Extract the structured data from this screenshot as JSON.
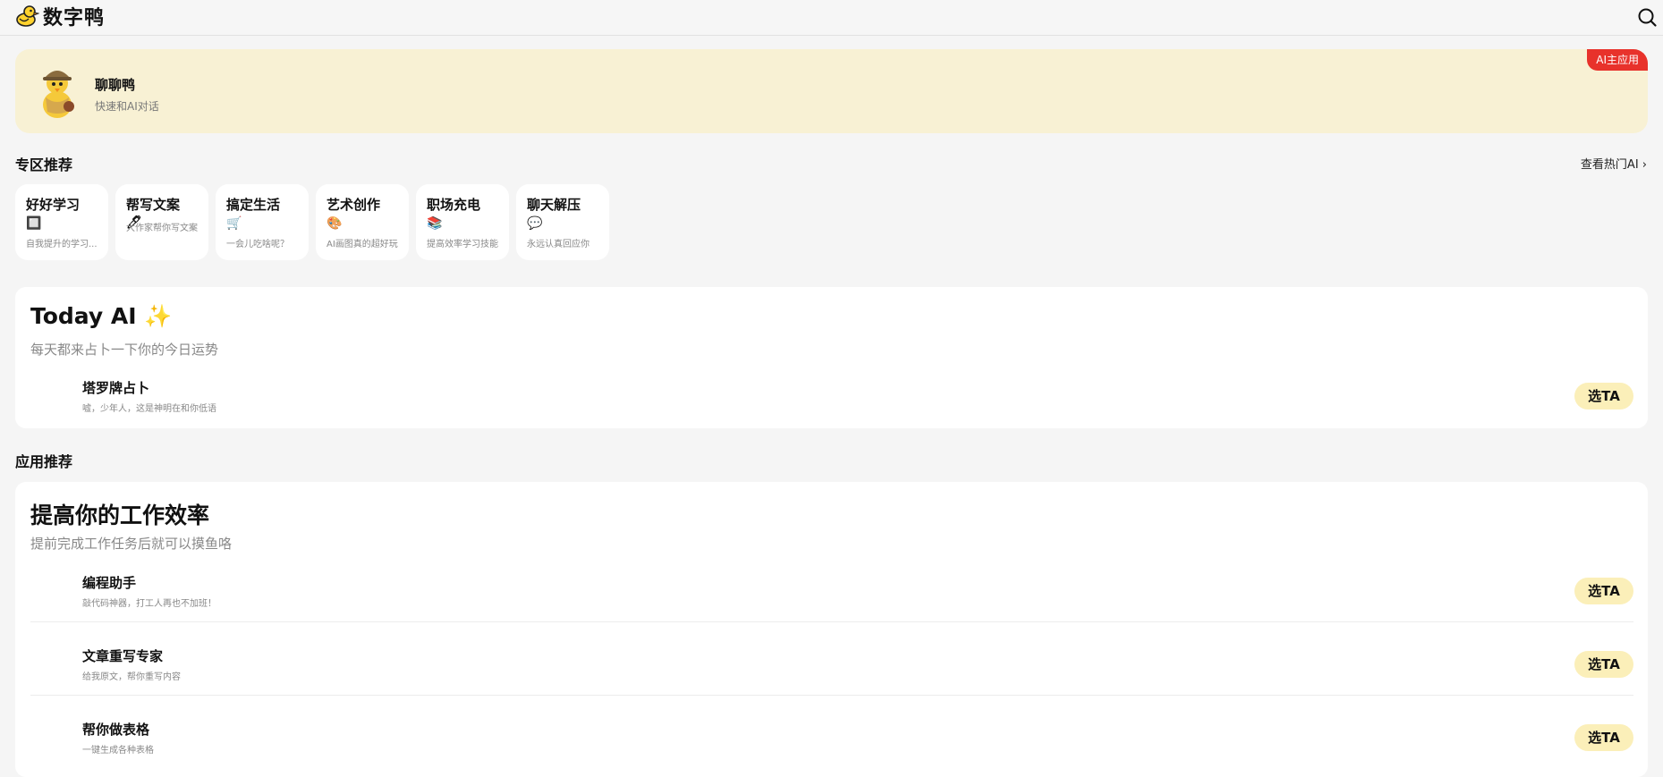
{
  "header": {
    "brand": "数字鸭",
    "logo_icon": "duck-logo-icon",
    "search_icon": "search-icon"
  },
  "banner": {
    "title": "聊聊鸭",
    "subtitle": "快速和AI对话",
    "badge": "AI主应用",
    "bg_color": "#f8f1d4",
    "badge_color": "#e8322b"
  },
  "zone": {
    "title": "专区推荐",
    "more_label": "查看热门AI",
    "cards": [
      {
        "title": "好好学习",
        "icon": "🔲",
        "subtitle": "自我提升的学习..."
      },
      {
        "title": "帮写文案",
        "icon": "🖊",
        "subtitle": "大作家帮你写文案"
      },
      {
        "title": "搞定生活",
        "icon": "🛒",
        "subtitle": "一会儿吃啥呢？"
      },
      {
        "title": "艺术创作",
        "icon": "🎨",
        "subtitle": "AI画图真的超好玩"
      },
      {
        "title": "职场充电",
        "icon": "📚",
        "subtitle": "提高效率学习技能"
      },
      {
        "title": "聊天解压",
        "icon": "💬",
        "subtitle": "永远认真回应你"
      }
    ]
  },
  "today": {
    "title": "Today AI",
    "icon": "✨",
    "subtitle": "每天都来占卜一下你的今日运势",
    "items": [
      {
        "title": "塔罗牌占卜",
        "subtitle": "嘘，少年人，这是神明在和你低语",
        "button": "选TA"
      }
    ]
  },
  "apps": {
    "section_title": "应用推荐",
    "title": "提高你的工作效率",
    "subtitle": "提前完成工作任务后就可以摸鱼咯",
    "items": [
      {
        "title": "编程助手",
        "subtitle": "敲代码神器，打工人再也不加班！",
        "button": "选TA"
      },
      {
        "title": "文章重写专家",
        "subtitle": "给我原文，帮你重写内容",
        "button": "选TA"
      },
      {
        "title": "帮你做表格",
        "subtitle": "一键生成各种表格",
        "button": "选TA"
      }
    ]
  }
}
